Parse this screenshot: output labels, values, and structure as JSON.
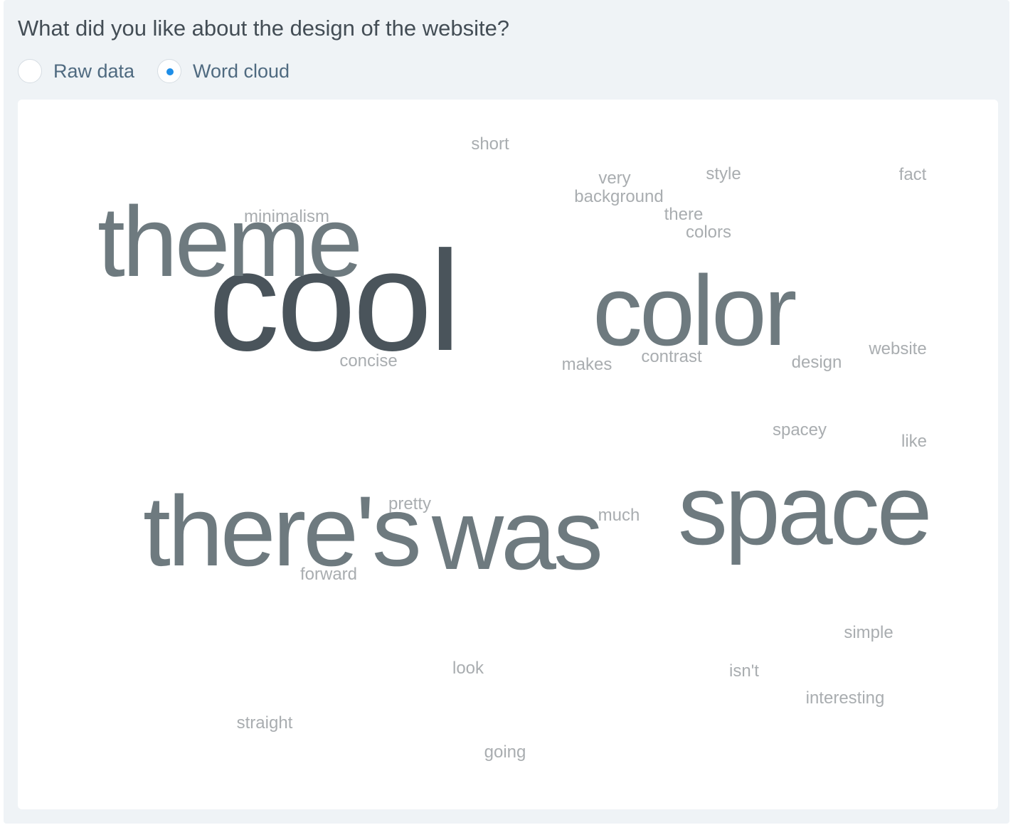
{
  "question": {
    "title": "What did you like about the design of the website?"
  },
  "view_toggle": {
    "options": [
      {
        "label": "Raw data",
        "selected": false
      },
      {
        "label": "Word cloud",
        "selected": true
      }
    ]
  },
  "colors": {
    "panel_background": "#eff3f6",
    "card_background": "#ffffff",
    "radio_selected_dot": "#1e8ee8",
    "word_dark": "#4a545b",
    "word_mid": "#6e7a7f",
    "word_light": "#a9adb0"
  },
  "word_cloud": {
    "words": [
      {
        "text": "cool",
        "tone": "dark"
      },
      {
        "text": "theme",
        "tone": "mid"
      },
      {
        "text": "color",
        "tone": "mid"
      },
      {
        "text": "there's",
        "tone": "mid"
      },
      {
        "text": "was",
        "tone": "mid"
      },
      {
        "text": "space",
        "tone": "mid"
      },
      {
        "text": "short",
        "tone": "light"
      },
      {
        "text": "very",
        "tone": "light"
      },
      {
        "text": "style",
        "tone": "light"
      },
      {
        "text": "fact",
        "tone": "light"
      },
      {
        "text": "background",
        "tone": "light"
      },
      {
        "text": "minimalism",
        "tone": "light"
      },
      {
        "text": "there",
        "tone": "light"
      },
      {
        "text": "colors",
        "tone": "light"
      },
      {
        "text": "concise",
        "tone": "light"
      },
      {
        "text": "makes",
        "tone": "light"
      },
      {
        "text": "contrast",
        "tone": "light"
      },
      {
        "text": "design",
        "tone": "light"
      },
      {
        "text": "website",
        "tone": "light"
      },
      {
        "text": "spacey",
        "tone": "light"
      },
      {
        "text": "like",
        "tone": "light"
      },
      {
        "text": "pretty",
        "tone": "light"
      },
      {
        "text": "much",
        "tone": "light"
      },
      {
        "text": "forward",
        "tone": "light"
      },
      {
        "text": "simple",
        "tone": "light"
      },
      {
        "text": "look",
        "tone": "light"
      },
      {
        "text": "isn't",
        "tone": "light"
      },
      {
        "text": "interesting",
        "tone": "light"
      },
      {
        "text": "straight",
        "tone": "light"
      },
      {
        "text": "going",
        "tone": "light"
      }
    ]
  }
}
